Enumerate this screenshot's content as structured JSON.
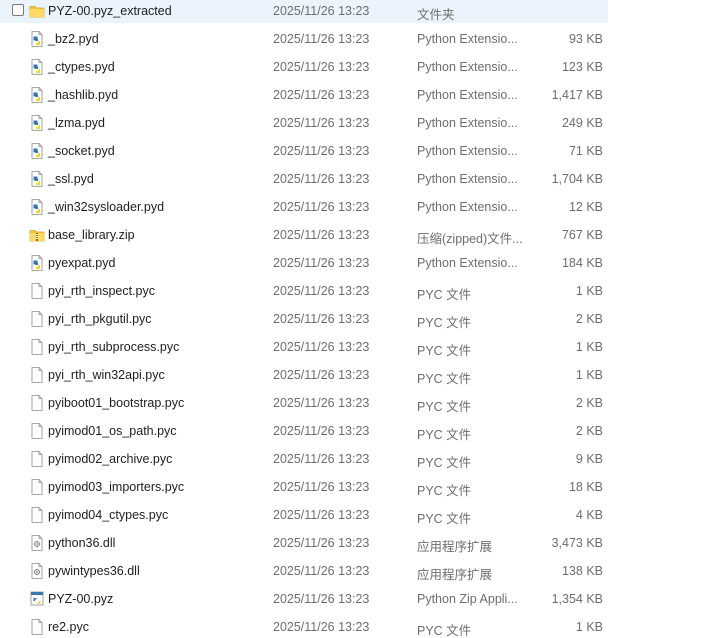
{
  "rows": [
    {
      "name": "PYZ-00.pyz_extracted",
      "date": "2025/11/26 13:23",
      "type": "文件夹",
      "size": "",
      "icon": "folder-icon",
      "selected": true
    },
    {
      "name": "_bz2.pyd",
      "date": "2025/11/26 13:23",
      "type": "Python Extensio...",
      "size": "93 KB",
      "icon": "python-file-icon"
    },
    {
      "name": "_ctypes.pyd",
      "date": "2025/11/26 13:23",
      "type": "Python Extensio...",
      "size": "123 KB",
      "icon": "python-file-icon"
    },
    {
      "name": "_hashlib.pyd",
      "date": "2025/11/26 13:23",
      "type": "Python Extensio...",
      "size": "1,417 KB",
      "icon": "python-file-icon"
    },
    {
      "name": "_lzma.pyd",
      "date": "2025/11/26 13:23",
      "type": "Python Extensio...",
      "size": "249 KB",
      "icon": "python-file-icon"
    },
    {
      "name": "_socket.pyd",
      "date": "2025/11/26 13:23",
      "type": "Python Extensio...",
      "size": "71 KB",
      "icon": "python-file-icon"
    },
    {
      "name": "_ssl.pyd",
      "date": "2025/11/26 13:23",
      "type": "Python Extensio...",
      "size": "1,704 KB",
      "icon": "python-file-icon"
    },
    {
      "name": "_win32sysloader.pyd",
      "date": "2025/11/26 13:23",
      "type": "Python Extensio...",
      "size": "12 KB",
      "icon": "python-file-icon"
    },
    {
      "name": "base_library.zip",
      "date": "2025/11/26 13:23",
      "type": "压缩(zipped)文件...",
      "size": "767 KB",
      "icon": "zip-folder-icon"
    },
    {
      "name": "pyexpat.pyd",
      "date": "2025/11/26 13:23",
      "type": "Python Extensio...",
      "size": "184 KB",
      "icon": "python-file-icon"
    },
    {
      "name": "pyi_rth_inspect.pyc",
      "date": "2025/11/26 13:23",
      "type": "PYC 文件",
      "size": "1 KB",
      "icon": "blank-file-icon"
    },
    {
      "name": "pyi_rth_pkgutil.pyc",
      "date": "2025/11/26 13:23",
      "type": "PYC 文件",
      "size": "2 KB",
      "icon": "blank-file-icon"
    },
    {
      "name": "pyi_rth_subprocess.pyc",
      "date": "2025/11/26 13:23",
      "type": "PYC 文件",
      "size": "1 KB",
      "icon": "blank-file-icon"
    },
    {
      "name": "pyi_rth_win32api.pyc",
      "date": "2025/11/26 13:23",
      "type": "PYC 文件",
      "size": "1 KB",
      "icon": "blank-file-icon"
    },
    {
      "name": "pyiboot01_bootstrap.pyc",
      "date": "2025/11/26 13:23",
      "type": "PYC 文件",
      "size": "2 KB",
      "icon": "blank-file-icon"
    },
    {
      "name": "pyimod01_os_path.pyc",
      "date": "2025/11/26 13:23",
      "type": "PYC 文件",
      "size": "2 KB",
      "icon": "blank-file-icon"
    },
    {
      "name": "pyimod02_archive.pyc",
      "date": "2025/11/26 13:23",
      "type": "PYC 文件",
      "size": "9 KB",
      "icon": "blank-file-icon"
    },
    {
      "name": "pyimod03_importers.pyc",
      "date": "2025/11/26 13:23",
      "type": "PYC 文件",
      "size": "18 KB",
      "icon": "blank-file-icon"
    },
    {
      "name": "pyimod04_ctypes.pyc",
      "date": "2025/11/26 13:23",
      "type": "PYC 文件",
      "size": "4 KB",
      "icon": "blank-file-icon"
    },
    {
      "name": "python36.dll",
      "date": "2025/11/26 13:23",
      "type": "应用程序扩展",
      "size": "3,473 KB",
      "icon": "dll-file-icon"
    },
    {
      "name": "pywintypes36.dll",
      "date": "2025/11/26 13:23",
      "type": "应用程序扩展",
      "size": "138 KB",
      "icon": "dll-file-icon"
    },
    {
      "name": "PYZ-00.pyz",
      "date": "2025/11/26 13:23",
      "type": "Python Zip Appli...",
      "size": "1,354 KB",
      "icon": "pyz-file-icon"
    },
    {
      "name": "re2.pyc",
      "date": "2025/11/26 13:23",
      "type": "PYC 文件",
      "size": "1 KB",
      "icon": "blank-file-icon"
    }
  ],
  "colors": {
    "selection": "#ebf4fd",
    "folder": "#f4c542",
    "python_blue": "#3776ab",
    "python_yellow": "#ffd43b"
  }
}
